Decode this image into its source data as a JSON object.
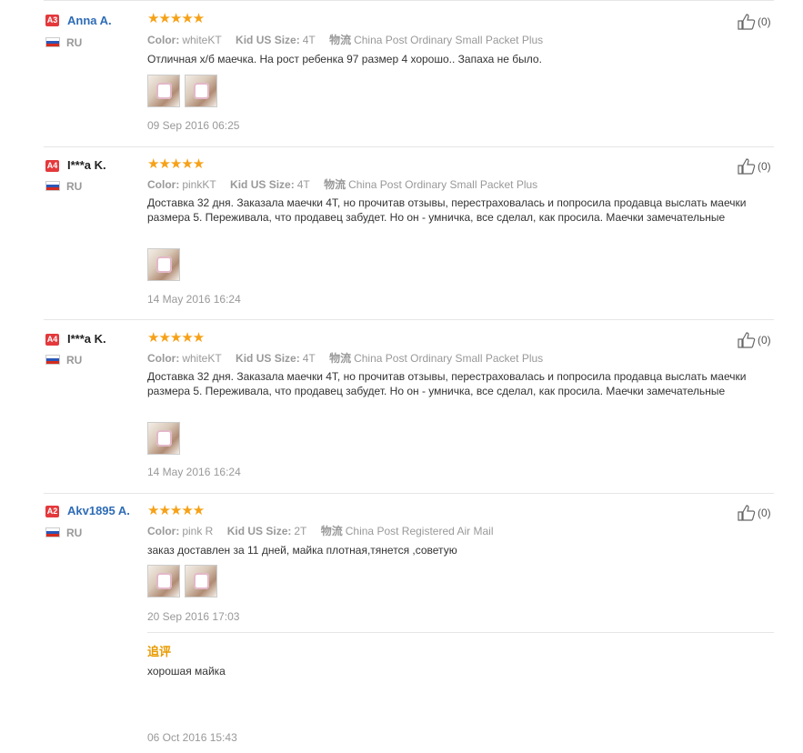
{
  "reviews": [
    {
      "level": "A3",
      "name": "Anna A.",
      "country": "RU",
      "stars": "★★★★★",
      "color_label": "Color:",
      "color_value": "whiteKT",
      "size_label": "Kid US Size:",
      "size_value": "4T",
      "ship_label": "物流",
      "ship_value": "China Post Ordinary Small Packet Plus",
      "text": "Отличная х/б маечка. На рост ребенка 97 размер 4 хорошо.. Запаха не было.",
      "date": "09 Sep 2016 06:25",
      "likes": "(0)"
    },
    {
      "level": "A4",
      "name": "I***a K.",
      "country": "RU",
      "stars": "★★★★★",
      "color_label": "Color:",
      "color_value": "pinkKT",
      "size_label": "Kid US Size:",
      "size_value": "4T",
      "ship_label": "物流",
      "ship_value": "China Post Ordinary Small Packet Plus",
      "text": "Доставка 32 дня. Заказала маечки 4Т, но прочитав отзывы, перестраховалась и попросила продавца выслать маечки размера 5. Переживала, что продавец забудет. Но он - умничка, все сделал, как просила. Маечки замечательные",
      "date": "14 May 2016 16:24",
      "likes": "(0)"
    },
    {
      "level": "A4",
      "name": "I***a K.",
      "country": "RU",
      "stars": "★★★★★",
      "color_label": "Color:",
      "color_value": "whiteKT",
      "size_label": "Kid US Size:",
      "size_value": "4T",
      "ship_label": "物流",
      "ship_value": "China Post Ordinary Small Packet Plus",
      "text": "Доставка 32 дня. Заказала маечки 4Т, но прочитав отзывы, перестраховалась и попросила продавца выслать маечки размера 5. Переживала, что продавец забудет. Но он - умничка, все сделал, как просила. Маечки замечательные",
      "date": "14 May 2016 16:24",
      "likes": "(0)"
    },
    {
      "level": "A2",
      "name": "Akv1895 A.",
      "country": "RU",
      "stars": "★★★★★",
      "color_label": "Color:",
      "color_value": "pink R",
      "size_label": "Kid US Size:",
      "size_value": "2T",
      "ship_label": "物流",
      "ship_value": "China Post Registered Air Mail",
      "text": "заказ доставлен за 11 дней, майка плотная,тянется ,советую",
      "date": "20 Sep 2016 17:03",
      "likes": "(0)",
      "followup_label": "追评",
      "followup_text": "хорошая майка",
      "followup_date": "06 Oct 2016 15:43"
    }
  ],
  "icons": {
    "like": "thumbs-up-icon",
    "flag": "russia-flag-icon",
    "star": "star-icon"
  },
  "colors": {
    "link": "#2e6cb6",
    "star": "#f6a117",
    "level_badge": "#e4393c",
    "followup": "#e89b00"
  }
}
